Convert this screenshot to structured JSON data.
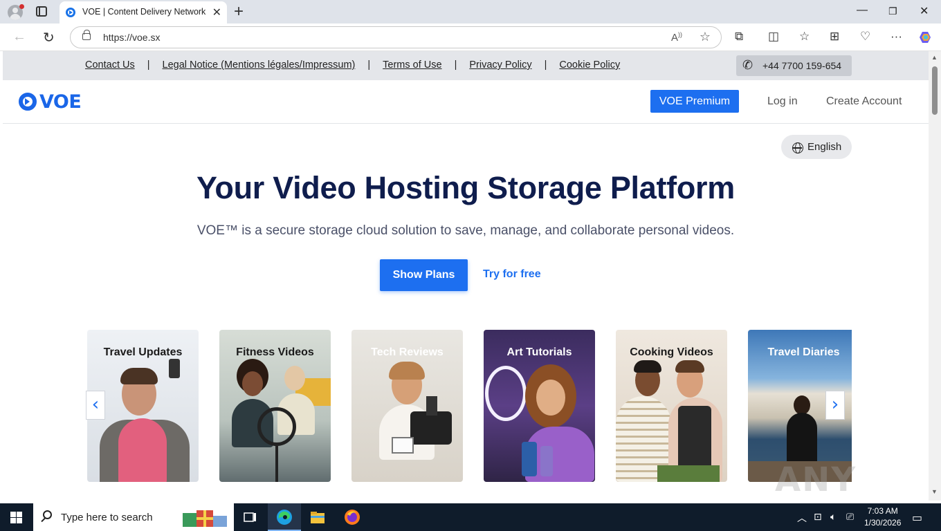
{
  "browser": {
    "tab_title": "VOE | Content Delivery Network (",
    "url": "https://voe.sx"
  },
  "topbar": {
    "links": [
      "Contact Us",
      "Legal Notice (Mentions légales/Impressum)",
      "Terms of Use",
      "Privacy Policy",
      "Cookie Policy"
    ],
    "separator": "|",
    "phone": "+44 7700 159-654"
  },
  "header": {
    "logo_text": "VOE",
    "premium_label": "VOE Premium",
    "login_label": "Log in",
    "create_label": "Create Account"
  },
  "language": {
    "label": "English"
  },
  "hero": {
    "title": "Your Video Hosting Storage Platform",
    "subtitle": "VOE™ is a secure storage cloud solution to save, manage, and collaborate personal videos.",
    "show_plans": "Show Plans",
    "try_free": "Try for free"
  },
  "carousel": {
    "cards": [
      {
        "caption": "Travel Updates"
      },
      {
        "caption": "Fitness Videos"
      },
      {
        "caption": "Tech Reviews"
      },
      {
        "caption": "Art Tutorials"
      },
      {
        "caption": "Cooking Videos"
      },
      {
        "caption": "Travel Diaries"
      }
    ]
  },
  "watermark": "ANY RUN",
  "taskbar": {
    "search_placeholder": "Type here to search",
    "time": "7:03 AM",
    "date": "1/30/2026"
  },
  "colors": {
    "brand_blue": "#1d6ff0",
    "title_navy": "#0f1d4d",
    "topbar_bg": "#e4e6ea",
    "taskbar_bg": "#0f1c2b"
  },
  "icons": [
    "profile-icon",
    "tab-actions-icon",
    "favicon-icon",
    "close-icon",
    "plus-icon",
    "back-icon",
    "reload-icon",
    "lock-icon",
    "read-aloud-icon",
    "star-icon",
    "extensions-icon",
    "split-screen-icon",
    "favorites-icon",
    "collections-icon",
    "browser-essentials-icon",
    "more-icon",
    "copilot-icon",
    "phone-icon",
    "globe-icon",
    "chevron-left-icon",
    "chevron-right-icon",
    "windows-start-icon",
    "search-icon",
    "task-view-icon",
    "edge-icon",
    "file-explorer-icon",
    "firefox-icon",
    "tray-chevron-icon",
    "network-icon",
    "volume-icon",
    "notification-icon"
  ]
}
